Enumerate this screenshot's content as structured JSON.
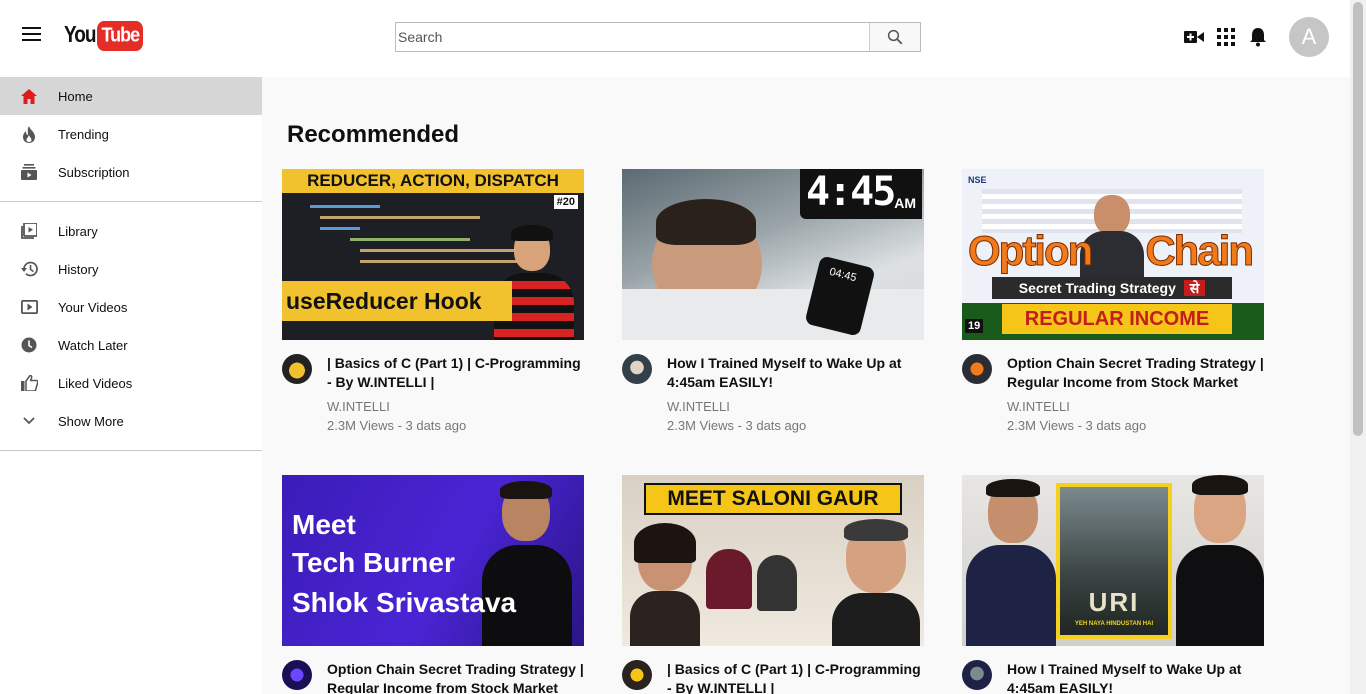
{
  "header": {
    "logo_you": "You",
    "logo_tube": "Tube",
    "search_placeholder": "Search",
    "avatar_letter": "A"
  },
  "sidebar": {
    "items": [
      {
        "label": "Home",
        "icon": "home-icon"
      },
      {
        "label": "Trending",
        "icon": "fire-icon"
      },
      {
        "label": "Subscription",
        "icon": "subscription-icon"
      },
      {
        "label": "Library",
        "icon": "library-icon"
      },
      {
        "label": "History",
        "icon": "history-icon"
      },
      {
        "label": "Your Videos",
        "icon": "your-videos-icon"
      },
      {
        "label": "Watch Later",
        "icon": "clock-icon"
      },
      {
        "label": "Liked Videos",
        "icon": "thumbs-up-icon"
      },
      {
        "label": "Show More",
        "icon": "chevron-down-icon"
      }
    ]
  },
  "main": {
    "title": "Recommended",
    "videos": [
      {
        "title": "| Basics of C (Part 1) | C-Programming - By W.INTELLI |",
        "channel": "W.INTELLI",
        "stats": "2.3M Views - 3 dats ago",
        "thumb": {
          "banner": "REDUCER, ACTION, DISPATCH",
          "caption": "useReducer Hook",
          "badge": "#20"
        }
      },
      {
        "title": "How I Trained Myself to Wake Up at 4:45am EASILY!",
        "channel": "W.INTELLI",
        "stats": "2.3M Views - 3 dats ago",
        "thumb": {
          "time": "4:45",
          "ampm": "AM",
          "phone": "04:45"
        }
      },
      {
        "title": "Option Chain Secret Trading Strategy | Regular Income from Stock Market",
        "channel": "W.INTELLI",
        "stats": "2.3M Views - 3 dats ago",
        "thumb": {
          "brand": "NSE",
          "big_left": "Option",
          "big_right": "Chain",
          "strip": "Secret Trading Strategy",
          "strip_hindi": "से",
          "bottom": "REGULAR INCOME",
          "num": "19"
        }
      },
      {
        "title": "Option Chain Secret Trading Strategy | Regular Income from Stock Market",
        "channel": "",
        "stats": "",
        "thumb": {
          "l1": "Meet",
          "l2": "Tech Burner",
          "l3": "Shlok Srivastava"
        }
      },
      {
        "title": "| Basics of C (Part 1) | C-Programming - By W.INTELLI |",
        "channel": "",
        "stats": "",
        "thumb": {
          "banner": "MEET SALONI GAUR"
        }
      },
      {
        "title": "How I Trained Myself to Wake Up at 4:45am EASILY!",
        "channel": "",
        "stats": "",
        "thumb": {
          "poster": "URI",
          "tag": "YEH NAYA HINDUSTAN HAI"
        }
      }
    ]
  }
}
